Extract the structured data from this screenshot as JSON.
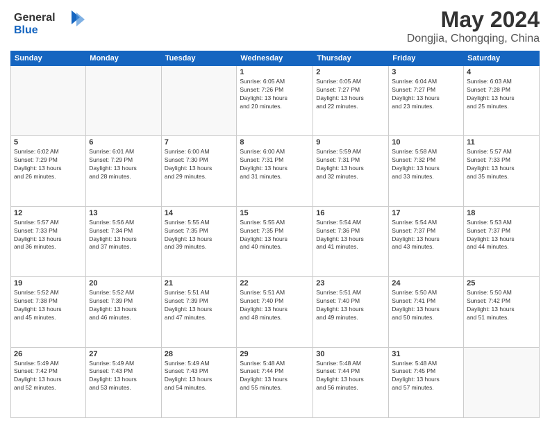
{
  "logo": {
    "line1": "General",
    "line2": "Blue"
  },
  "title": "May 2024",
  "subtitle": "Dongjia, Chongqing, China",
  "days_of_week": [
    "Sunday",
    "Monday",
    "Tuesday",
    "Wednesday",
    "Thursday",
    "Friday",
    "Saturday"
  ],
  "weeks": [
    [
      {
        "day": "",
        "info": ""
      },
      {
        "day": "",
        "info": ""
      },
      {
        "day": "",
        "info": ""
      },
      {
        "day": "1",
        "info": "Sunrise: 6:05 AM\nSunset: 7:26 PM\nDaylight: 13 hours\nand 20 minutes."
      },
      {
        "day": "2",
        "info": "Sunrise: 6:05 AM\nSunset: 7:27 PM\nDaylight: 13 hours\nand 22 minutes."
      },
      {
        "day": "3",
        "info": "Sunrise: 6:04 AM\nSunset: 7:27 PM\nDaylight: 13 hours\nand 23 minutes."
      },
      {
        "day": "4",
        "info": "Sunrise: 6:03 AM\nSunset: 7:28 PM\nDaylight: 13 hours\nand 25 minutes."
      }
    ],
    [
      {
        "day": "5",
        "info": "Sunrise: 6:02 AM\nSunset: 7:29 PM\nDaylight: 13 hours\nand 26 minutes."
      },
      {
        "day": "6",
        "info": "Sunrise: 6:01 AM\nSunset: 7:29 PM\nDaylight: 13 hours\nand 28 minutes."
      },
      {
        "day": "7",
        "info": "Sunrise: 6:00 AM\nSunset: 7:30 PM\nDaylight: 13 hours\nand 29 minutes."
      },
      {
        "day": "8",
        "info": "Sunrise: 6:00 AM\nSunset: 7:31 PM\nDaylight: 13 hours\nand 31 minutes."
      },
      {
        "day": "9",
        "info": "Sunrise: 5:59 AM\nSunset: 7:31 PM\nDaylight: 13 hours\nand 32 minutes."
      },
      {
        "day": "10",
        "info": "Sunrise: 5:58 AM\nSunset: 7:32 PM\nDaylight: 13 hours\nand 33 minutes."
      },
      {
        "day": "11",
        "info": "Sunrise: 5:57 AM\nSunset: 7:33 PM\nDaylight: 13 hours\nand 35 minutes."
      }
    ],
    [
      {
        "day": "12",
        "info": "Sunrise: 5:57 AM\nSunset: 7:33 PM\nDaylight: 13 hours\nand 36 minutes."
      },
      {
        "day": "13",
        "info": "Sunrise: 5:56 AM\nSunset: 7:34 PM\nDaylight: 13 hours\nand 37 minutes."
      },
      {
        "day": "14",
        "info": "Sunrise: 5:55 AM\nSunset: 7:35 PM\nDaylight: 13 hours\nand 39 minutes."
      },
      {
        "day": "15",
        "info": "Sunrise: 5:55 AM\nSunset: 7:35 PM\nDaylight: 13 hours\nand 40 minutes."
      },
      {
        "day": "16",
        "info": "Sunrise: 5:54 AM\nSunset: 7:36 PM\nDaylight: 13 hours\nand 41 minutes."
      },
      {
        "day": "17",
        "info": "Sunrise: 5:54 AM\nSunset: 7:37 PM\nDaylight: 13 hours\nand 43 minutes."
      },
      {
        "day": "18",
        "info": "Sunrise: 5:53 AM\nSunset: 7:37 PM\nDaylight: 13 hours\nand 44 minutes."
      }
    ],
    [
      {
        "day": "19",
        "info": "Sunrise: 5:52 AM\nSunset: 7:38 PM\nDaylight: 13 hours\nand 45 minutes."
      },
      {
        "day": "20",
        "info": "Sunrise: 5:52 AM\nSunset: 7:39 PM\nDaylight: 13 hours\nand 46 minutes."
      },
      {
        "day": "21",
        "info": "Sunrise: 5:51 AM\nSunset: 7:39 PM\nDaylight: 13 hours\nand 47 minutes."
      },
      {
        "day": "22",
        "info": "Sunrise: 5:51 AM\nSunset: 7:40 PM\nDaylight: 13 hours\nand 48 minutes."
      },
      {
        "day": "23",
        "info": "Sunrise: 5:51 AM\nSunset: 7:40 PM\nDaylight: 13 hours\nand 49 minutes."
      },
      {
        "day": "24",
        "info": "Sunrise: 5:50 AM\nSunset: 7:41 PM\nDaylight: 13 hours\nand 50 minutes."
      },
      {
        "day": "25",
        "info": "Sunrise: 5:50 AM\nSunset: 7:42 PM\nDaylight: 13 hours\nand 51 minutes."
      }
    ],
    [
      {
        "day": "26",
        "info": "Sunrise: 5:49 AM\nSunset: 7:42 PM\nDaylight: 13 hours\nand 52 minutes."
      },
      {
        "day": "27",
        "info": "Sunrise: 5:49 AM\nSunset: 7:43 PM\nDaylight: 13 hours\nand 53 minutes."
      },
      {
        "day": "28",
        "info": "Sunrise: 5:49 AM\nSunset: 7:43 PM\nDaylight: 13 hours\nand 54 minutes."
      },
      {
        "day": "29",
        "info": "Sunrise: 5:48 AM\nSunset: 7:44 PM\nDaylight: 13 hours\nand 55 minutes."
      },
      {
        "day": "30",
        "info": "Sunrise: 5:48 AM\nSunset: 7:44 PM\nDaylight: 13 hours\nand 56 minutes."
      },
      {
        "day": "31",
        "info": "Sunrise: 5:48 AM\nSunset: 7:45 PM\nDaylight: 13 hours\nand 57 minutes."
      },
      {
        "day": "",
        "info": ""
      }
    ]
  ]
}
